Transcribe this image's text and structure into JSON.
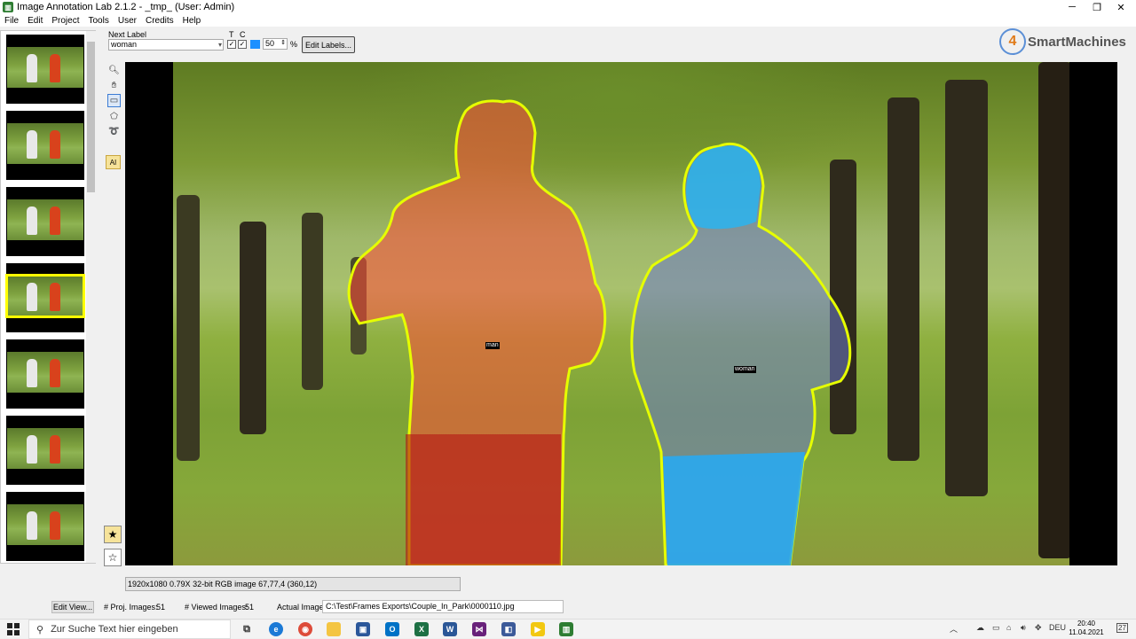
{
  "window": {
    "title": "Image Annotation Lab 2.1.2 - _tmp_ (User: Admin)",
    "minimize": "─",
    "maximize": "❐",
    "close": "✕"
  },
  "menu": [
    "File",
    "Edit",
    "Project",
    "Tools",
    "User",
    "Credits",
    "Help"
  ],
  "toolbar": {
    "next_label_caption": "Next Label",
    "next_label_value": "woman",
    "t_caption": "T",
    "c_caption": "C",
    "opacity_value": "50",
    "percent_sign": "%",
    "edit_labels_button": "Edit Labels...",
    "accent_color": "#1e90ff"
  },
  "logo": {
    "badge": "4",
    "text": "SmartMachines"
  },
  "tools": [
    "zoom-icon",
    "hand-icon",
    "rectangle-icon",
    "polygon-icon",
    "lasso-icon"
  ],
  "ai_button": "AI",
  "thumbnails": {
    "count": 7,
    "selected_index": 3
  },
  "segments": [
    {
      "label": "man",
      "color": "#ff3c28"
    },
    {
      "label": "woman",
      "color": "#2aa8f0"
    }
  ],
  "image_info": "1920x1080 0.79X 32-bit RGB image 67,77,4    (360,12)",
  "status": {
    "edit_view_button": "Edit View...",
    "proj_images_label": "# Proj. Images:",
    "proj_images_value": "51",
    "viewed_images_label": "# Viewed Images:",
    "viewed_images_value": "51",
    "actual_image_label": "Actual Image:",
    "actual_image_path": "C:\\Test\\Frames Exports\\Couple_In_Park\\0000110.jpg"
  },
  "taskbar": {
    "search_placeholder": "Zur Suche Text hier eingeben",
    "language": "DEU",
    "time": "20:40",
    "date": "11.04.2021",
    "notification_count": "27"
  }
}
